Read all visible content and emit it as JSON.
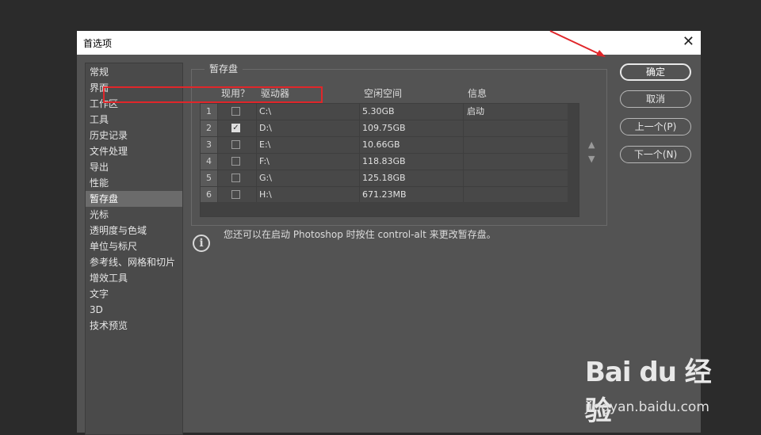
{
  "dialog": {
    "title": "首选项",
    "close_glyph": "✕"
  },
  "sidebar": {
    "items": [
      {
        "label": "常规"
      },
      {
        "label": "界面"
      },
      {
        "label": "工作区"
      },
      {
        "label": "工具"
      },
      {
        "label": "历史记录"
      },
      {
        "label": "文件处理"
      },
      {
        "label": "导出"
      },
      {
        "label": "性能"
      },
      {
        "label": "暂存盘",
        "active": true
      },
      {
        "label": "光标"
      },
      {
        "label": "透明度与色域"
      },
      {
        "label": "单位与标尺"
      },
      {
        "label": "参考线、网格和切片"
      },
      {
        "label": "增效工具"
      },
      {
        "label": "文字"
      },
      {
        "label": "3D"
      },
      {
        "label": "技术预览"
      }
    ]
  },
  "scratch": {
    "group_title": "暂存盘",
    "headers": {
      "active": "现用？",
      "drive": "驱动器",
      "free_space": "空闲空间",
      "info": "信息"
    },
    "rows": [
      {
        "num": "1",
        "checked": false,
        "drive": "C:\\",
        "free": "5.30GB",
        "info": "启动"
      },
      {
        "num": "2",
        "checked": true,
        "drive": "D:\\",
        "free": "109.75GB",
        "info": ""
      },
      {
        "num": "3",
        "checked": false,
        "drive": "E:\\",
        "free": "10.66GB",
        "info": ""
      },
      {
        "num": "4",
        "checked": false,
        "drive": "F:\\",
        "free": "118.83GB",
        "info": ""
      },
      {
        "num": "5",
        "checked": false,
        "drive": "G:\\",
        "free": "125.18GB",
        "info": ""
      },
      {
        "num": "6",
        "checked": false,
        "drive": "H:\\",
        "free": "671.23MB",
        "info": ""
      }
    ],
    "move_up_glyph": "▲",
    "move_down_glyph": "▼",
    "hint": "您还可以在启动 Photoshop 时按住 control-alt 来更改暂存盘。",
    "info_glyph": "i"
  },
  "buttons": {
    "ok": "确定",
    "cancel": "取消",
    "prev": "上一个(P)",
    "next": "下一个(N)"
  },
  "watermark": {
    "brand": "Bai du 经验",
    "url": "jingyan.baidu.com"
  },
  "colors": {
    "highlight": "#e0262a",
    "dialog_bg": "#535353"
  }
}
